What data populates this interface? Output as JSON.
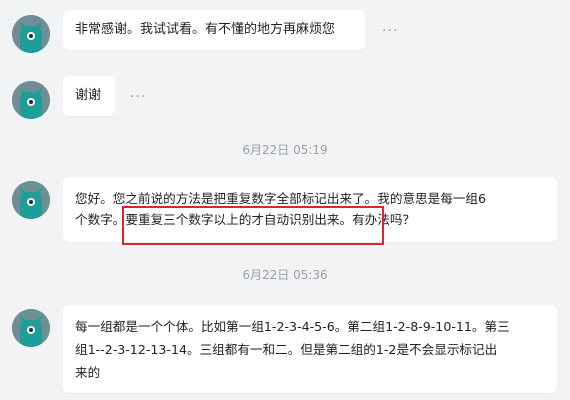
{
  "messages": [
    {
      "id": "m1",
      "text": "非常感谢。我试试看。有不懂的地方再麻烦您",
      "more": "···"
    },
    {
      "id": "m2",
      "text": "谢谢",
      "more": "···"
    },
    {
      "id": "m3",
      "lines": [
        "您好。您之前说的方法是把重复数字全部标记出来了。我的意思是每一组6",
        "个数字。要重复三个数字以上的才自动识别出来。有办法吗？"
      ]
    },
    {
      "id": "m4",
      "lines": [
        "每一组都是一个个体。比如第一组1-2-3-4-5-6。第二组1-2-8-9-10-11。第三",
        "组1--2-3-12-13-14。三组都有一和二。但是第二组的1-2是不会显示标记出",
        "来的"
      ]
    }
  ],
  "timestamps": [
    "6月22日 05:19",
    "6月22日 05:36"
  ],
  "colors": {
    "background": "#f1f3f5",
    "bubble": "#ffffff",
    "avatar": "#6f8f95",
    "avatar_face": "#1e9e9a",
    "highlight": "#e0242b"
  },
  "icons": {
    "avatar": "teal-cat-avatar-icon",
    "more": "more-dots-icon"
  }
}
